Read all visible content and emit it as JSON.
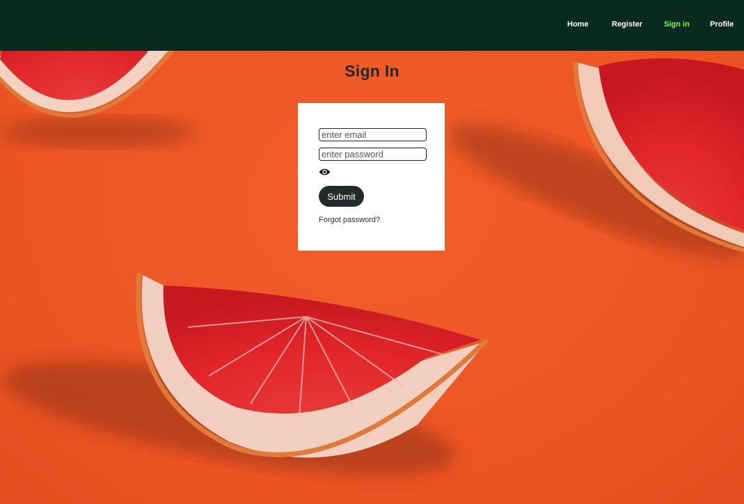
{
  "nav": {
    "items": [
      {
        "label": "Home",
        "active": false
      },
      {
        "label": "Register",
        "active": false
      },
      {
        "label": "Sign in",
        "active": true
      },
      {
        "label": "Profile",
        "active": false
      }
    ],
    "active_color": "#7dfc4a",
    "background": "#0a2a1e"
  },
  "page": {
    "title": "Sign In",
    "background_image": "grapefruit slices on orange background"
  },
  "form": {
    "email_placeholder": "enter email",
    "password_placeholder": "enter password",
    "toggle_icon": "eye-icon",
    "submit_label": "Submit",
    "forgot_label": "Forgot password?"
  },
  "colors": {
    "accent_orange": "#ee5a2a",
    "button_dark": "#222b2a"
  }
}
